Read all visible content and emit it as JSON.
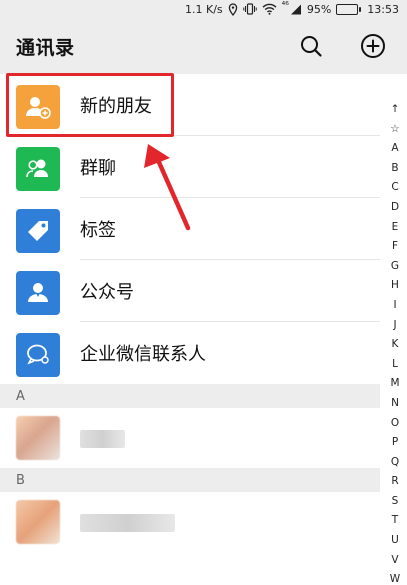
{
  "status_bar": {
    "speed": "1.1 K/s",
    "signal_label": "⁴⁶",
    "battery": "95%",
    "battery_level": 0.95,
    "time": "13:53"
  },
  "header": {
    "title": "通讯录"
  },
  "functions": [
    {
      "label": "新的朋友",
      "icon": "add-friend-icon",
      "color": "#f5a23d"
    },
    {
      "label": "群聊",
      "icon": "group-chat-icon",
      "color": "#1fb954"
    },
    {
      "label": "标签",
      "icon": "tag-icon",
      "color": "#2f7fd8"
    },
    {
      "label": "公众号",
      "icon": "official-account-icon",
      "color": "#2f7fd8"
    },
    {
      "label": "企业微信联系人",
      "icon": "wecom-contact-icon",
      "color": "#2f7fd8"
    }
  ],
  "sections": [
    {
      "letter": "A"
    },
    {
      "letter": "B"
    }
  ],
  "alphabet_index": [
    "↑",
    "☆",
    "A",
    "B",
    "C",
    "D",
    "E",
    "F",
    "G",
    "H",
    "I",
    "J",
    "K",
    "L",
    "M",
    "N",
    "O",
    "P",
    "Q",
    "R",
    "S",
    "T",
    "U",
    "V",
    "W"
  ],
  "highlight_color": "#e2262b"
}
